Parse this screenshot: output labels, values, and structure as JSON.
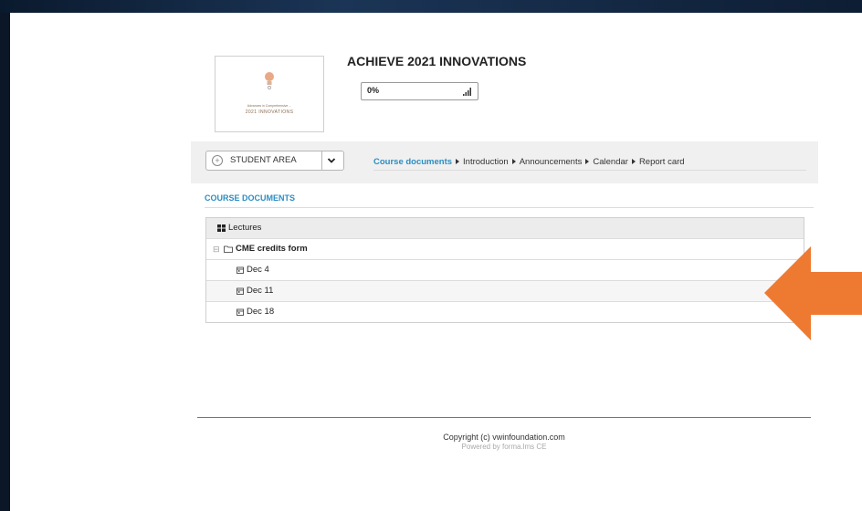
{
  "logo": {
    "line1": "Advances in Comprehensive ...",
    "line2": "2021 INNOVATIONS"
  },
  "course": {
    "title": "ACHIEVE 2021 INNOVATIONS",
    "progress": "0%"
  },
  "nav": {
    "student_area": "STUDENT AREA",
    "breadcrumb": [
      {
        "label": "Course documents",
        "active": true
      },
      {
        "label": "Introduction"
      },
      {
        "label": "Announcements"
      },
      {
        "label": "Calendar"
      },
      {
        "label": "Report card"
      }
    ]
  },
  "section_title": "COURSE DOCUMENTS",
  "documents": {
    "header": "Lectures",
    "folder": "CME credits form",
    "items": [
      "Dec 4",
      "Dec 11",
      "Dec 18"
    ]
  },
  "footer": {
    "copyright": "Copyright (c) vwinfoundation.com",
    "powered": "Powered by forma.lms CE"
  },
  "colors": {
    "accent": "#2a8ec2",
    "arrow": "#ee7a32"
  }
}
